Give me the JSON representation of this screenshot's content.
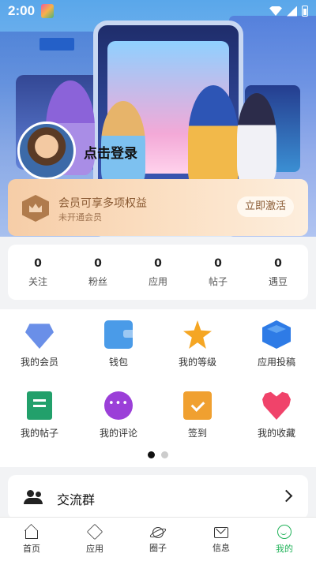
{
  "status_bar": {
    "time": "2:00"
  },
  "hero": {
    "sign_text": ""
  },
  "profile": {
    "login_label": "点击登录"
  },
  "vip": {
    "title": "会员可享多项权益",
    "subtitle": "未开通会员",
    "activate_label": "立即激活"
  },
  "stats": [
    {
      "value": "0",
      "label": "关注"
    },
    {
      "value": "0",
      "label": "粉丝"
    },
    {
      "value": "0",
      "label": "应用"
    },
    {
      "value": "0",
      "label": "帖子"
    },
    {
      "value": "0",
      "label": "遇豆"
    }
  ],
  "grid": [
    {
      "label": "我的会员",
      "icon": "diamond-icon",
      "color": "#6a8fe8"
    },
    {
      "label": "钱包",
      "icon": "wallet-icon",
      "color": "#4a9be8"
    },
    {
      "label": "我的等级",
      "icon": "star-icon",
      "color": "#f5a623"
    },
    {
      "label": "应用投稿",
      "icon": "cube-icon",
      "color": "#2e7be6"
    },
    {
      "label": "我的帖子",
      "icon": "scroll-icon",
      "color": "#22a06b"
    },
    {
      "label": "我的评论",
      "icon": "comment-icon",
      "color": "#9b3fd8"
    },
    {
      "label": "签到",
      "icon": "calendar-icon",
      "color": "#f0a030"
    },
    {
      "label": "我的收藏",
      "icon": "heart-icon",
      "color": "#f0436a"
    }
  ],
  "pager": {
    "pages": 2,
    "current": 1
  },
  "group": {
    "label": "交流群"
  },
  "nav": [
    {
      "label": "首页",
      "icon": "home-icon"
    },
    {
      "label": "应用",
      "icon": "box-icon"
    },
    {
      "label": "圈子",
      "icon": "planet-icon"
    },
    {
      "label": "信息",
      "icon": "mail-icon"
    },
    {
      "label": "我的",
      "icon": "me-icon",
      "active": true
    }
  ],
  "colors": {
    "accent": "#22b35a",
    "vip_text": "#8a5a33"
  }
}
